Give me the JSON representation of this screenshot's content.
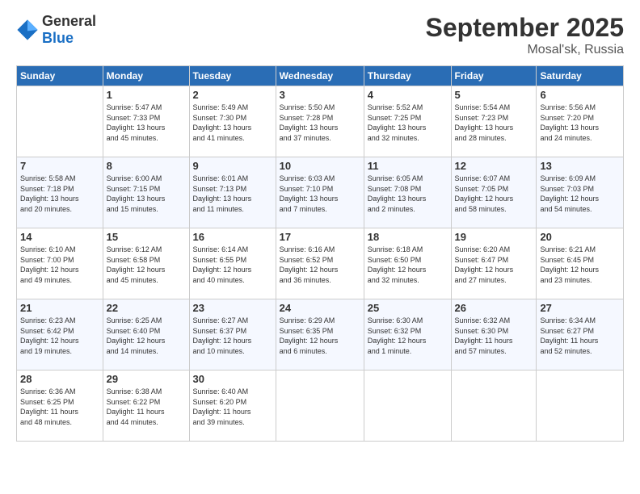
{
  "header": {
    "logo_general": "General",
    "logo_blue": "Blue",
    "month_title": "September 2025",
    "location": "Mosal'sk, Russia"
  },
  "days_of_week": [
    "Sunday",
    "Monday",
    "Tuesday",
    "Wednesday",
    "Thursday",
    "Friday",
    "Saturday"
  ],
  "weeks": [
    [
      {
        "day": "",
        "info": ""
      },
      {
        "day": "1",
        "info": "Sunrise: 5:47 AM\nSunset: 7:33 PM\nDaylight: 13 hours\nand 45 minutes."
      },
      {
        "day": "2",
        "info": "Sunrise: 5:49 AM\nSunset: 7:30 PM\nDaylight: 13 hours\nand 41 minutes."
      },
      {
        "day": "3",
        "info": "Sunrise: 5:50 AM\nSunset: 7:28 PM\nDaylight: 13 hours\nand 37 minutes."
      },
      {
        "day": "4",
        "info": "Sunrise: 5:52 AM\nSunset: 7:25 PM\nDaylight: 13 hours\nand 32 minutes."
      },
      {
        "day": "5",
        "info": "Sunrise: 5:54 AM\nSunset: 7:23 PM\nDaylight: 13 hours\nand 28 minutes."
      },
      {
        "day": "6",
        "info": "Sunrise: 5:56 AM\nSunset: 7:20 PM\nDaylight: 13 hours\nand 24 minutes."
      }
    ],
    [
      {
        "day": "7",
        "info": "Sunrise: 5:58 AM\nSunset: 7:18 PM\nDaylight: 13 hours\nand 20 minutes."
      },
      {
        "day": "8",
        "info": "Sunrise: 6:00 AM\nSunset: 7:15 PM\nDaylight: 13 hours\nand 15 minutes."
      },
      {
        "day": "9",
        "info": "Sunrise: 6:01 AM\nSunset: 7:13 PM\nDaylight: 13 hours\nand 11 minutes."
      },
      {
        "day": "10",
        "info": "Sunrise: 6:03 AM\nSunset: 7:10 PM\nDaylight: 13 hours\nand 7 minutes."
      },
      {
        "day": "11",
        "info": "Sunrise: 6:05 AM\nSunset: 7:08 PM\nDaylight: 13 hours\nand 2 minutes."
      },
      {
        "day": "12",
        "info": "Sunrise: 6:07 AM\nSunset: 7:05 PM\nDaylight: 12 hours\nand 58 minutes."
      },
      {
        "day": "13",
        "info": "Sunrise: 6:09 AM\nSunset: 7:03 PM\nDaylight: 12 hours\nand 54 minutes."
      }
    ],
    [
      {
        "day": "14",
        "info": "Sunrise: 6:10 AM\nSunset: 7:00 PM\nDaylight: 12 hours\nand 49 minutes."
      },
      {
        "day": "15",
        "info": "Sunrise: 6:12 AM\nSunset: 6:58 PM\nDaylight: 12 hours\nand 45 minutes."
      },
      {
        "day": "16",
        "info": "Sunrise: 6:14 AM\nSunset: 6:55 PM\nDaylight: 12 hours\nand 40 minutes."
      },
      {
        "day": "17",
        "info": "Sunrise: 6:16 AM\nSunset: 6:52 PM\nDaylight: 12 hours\nand 36 minutes."
      },
      {
        "day": "18",
        "info": "Sunrise: 6:18 AM\nSunset: 6:50 PM\nDaylight: 12 hours\nand 32 minutes."
      },
      {
        "day": "19",
        "info": "Sunrise: 6:20 AM\nSunset: 6:47 PM\nDaylight: 12 hours\nand 27 minutes."
      },
      {
        "day": "20",
        "info": "Sunrise: 6:21 AM\nSunset: 6:45 PM\nDaylight: 12 hours\nand 23 minutes."
      }
    ],
    [
      {
        "day": "21",
        "info": "Sunrise: 6:23 AM\nSunset: 6:42 PM\nDaylight: 12 hours\nand 19 minutes."
      },
      {
        "day": "22",
        "info": "Sunrise: 6:25 AM\nSunset: 6:40 PM\nDaylight: 12 hours\nand 14 minutes."
      },
      {
        "day": "23",
        "info": "Sunrise: 6:27 AM\nSunset: 6:37 PM\nDaylight: 12 hours\nand 10 minutes."
      },
      {
        "day": "24",
        "info": "Sunrise: 6:29 AM\nSunset: 6:35 PM\nDaylight: 12 hours\nand 6 minutes."
      },
      {
        "day": "25",
        "info": "Sunrise: 6:30 AM\nSunset: 6:32 PM\nDaylight: 12 hours\nand 1 minute."
      },
      {
        "day": "26",
        "info": "Sunrise: 6:32 AM\nSunset: 6:30 PM\nDaylight: 11 hours\nand 57 minutes."
      },
      {
        "day": "27",
        "info": "Sunrise: 6:34 AM\nSunset: 6:27 PM\nDaylight: 11 hours\nand 52 minutes."
      }
    ],
    [
      {
        "day": "28",
        "info": "Sunrise: 6:36 AM\nSunset: 6:25 PM\nDaylight: 11 hours\nand 48 minutes."
      },
      {
        "day": "29",
        "info": "Sunrise: 6:38 AM\nSunset: 6:22 PM\nDaylight: 11 hours\nand 44 minutes."
      },
      {
        "day": "30",
        "info": "Sunrise: 6:40 AM\nSunset: 6:20 PM\nDaylight: 11 hours\nand 39 minutes."
      },
      {
        "day": "",
        "info": ""
      },
      {
        "day": "",
        "info": ""
      },
      {
        "day": "",
        "info": ""
      },
      {
        "day": "",
        "info": ""
      }
    ]
  ]
}
